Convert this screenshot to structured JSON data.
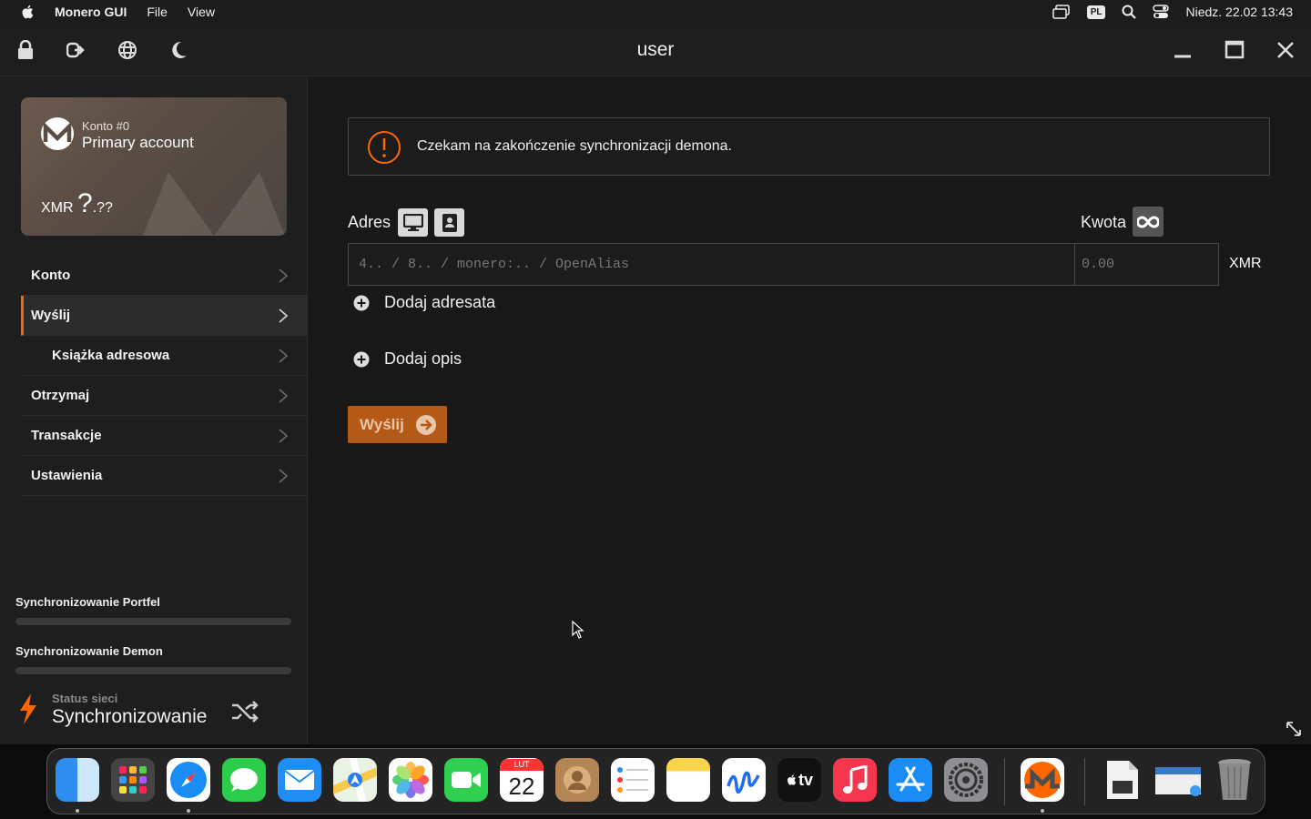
{
  "menubar": {
    "app_name": "Monero GUI",
    "menu_file": "File",
    "menu_view": "View",
    "keyboard_layout": "PL",
    "datetime": "Niedz. 22.02  13:43"
  },
  "window": {
    "title": "user"
  },
  "account_card": {
    "account_number": "Konto #0",
    "account_name": "Primary account",
    "currency": "XMR",
    "balance_big": "?",
    "balance_small": ".??"
  },
  "nav": {
    "items": [
      {
        "label": "Konto"
      },
      {
        "label": "Wyślij"
      },
      {
        "label": "Książka adresowa"
      },
      {
        "label": "Otrzymaj"
      },
      {
        "label": "Transakcje"
      },
      {
        "label": "Ustawienia"
      }
    ]
  },
  "sync": {
    "wallet_label": "Synchronizowanie Portfel",
    "wallet_progress": 0,
    "daemon_label": "Synchronizowanie Demon",
    "daemon_progress": 0
  },
  "network": {
    "status_label": "Status sieci",
    "status_value": "Synchronizowanie"
  },
  "alert": {
    "text": "Czekam na zakończenie synchronizacji demona."
  },
  "send_form": {
    "address_label": "Adres",
    "address_placeholder": "4.. / 8.. / monero:.. / OpenAlias",
    "amount_label": "Kwota",
    "amount_placeholder": "0.00",
    "amount_unit": "XMR",
    "add_recipient": "Dodaj adresata",
    "add_description": "Dodaj opis",
    "send_button": "Wyślij"
  },
  "dock": {
    "calendar_month": "LUT",
    "calendar_day": "22",
    "tv_label": "tv"
  },
  "colors": {
    "accent": "#ff6600",
    "send_button": "#b45a16",
    "background": "#181818"
  }
}
